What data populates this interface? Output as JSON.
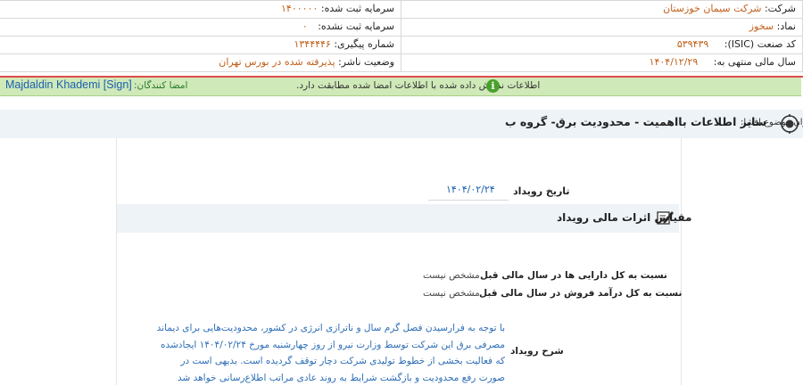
{
  "header": {
    "company_label": "شرکت:",
    "company_value": "شرکت سیمان خوزستان",
    "symbol_label": "نماد:",
    "symbol_value": "سخوز",
    "isic_label": "کد صنعت (ISIC):",
    "isic_value": "۵۳۹۴۳۹",
    "fiscal_year_label": "سال مالی منتهی به:",
    "fiscal_year_value": "۱۴۰۴/۱۲/۲۹",
    "registered_capital_label": "سرمایه ثبت شده:",
    "registered_capital_value": "۱۴۰۰۰۰۰",
    "unregistered_capital_label": "سرمایه ثبت نشده:",
    "unregistered_capital_value": "۰",
    "tracking_label": "شماره پیگیری:",
    "tracking_value": "۱۳۴۴۴۴۶",
    "publisher_status_label": "وضعیت ناشر:",
    "publisher_status_value": "پذیرفته شده در بورس تهران"
  },
  "signature": {
    "signer_label": "امضا کنندگان:",
    "signer_link": "Majdaldin Khademi [Sign]",
    "verify_message": "اطلاعات نمایش داده شده با اطلاعات امضا شده مطابقت دارد."
  },
  "title": {
    "label": "عنوان موضوع افشا:",
    "value": "سایر اطلاعات بااهمیت - محدودیت برق- گروه ب"
  },
  "event": {
    "date_label": "تاریخ رویداد",
    "date_value": "۱۴۰۴/۰۲/۲۴",
    "section_title": "مقیاس اثرات مالی رویداد",
    "assets_ratio_label": "نسبت به کل دارایی ها در سال مالی قبل",
    "assets_ratio_value": "مشخص نیست",
    "revenue_ratio_label": "نسبت به کل درآمد فروش در سال مالی قبل",
    "revenue_ratio_value": "مشخص نیست",
    "description_label": "شرح رویداد",
    "description_text": "با توجه به فرارسیدن فصل گرم سال و ناترازی انرژی در کشور، محدودیت‌هایی برای دیماند مصرفی برق این شرکت توسط وزارت نیرو از روز چهارشنبه مورخ ۱۴۰۴/۰۲/۲۴ ایجادشده که فعالیت بخشی از خطوط تولیدی شرکت دچار توقف گردیده است. بدیهی است در صورت رفع محدودیت و بازگشت شرایط به روند عادی مراتب اطلاع‌رسانی خواهد شد"
  },
  "colors": {
    "accent_value": "#c0601b",
    "link_blue": "#1b5fb0",
    "banner_green": "#cfe9b8",
    "separator_red": "#e04a4a"
  }
}
